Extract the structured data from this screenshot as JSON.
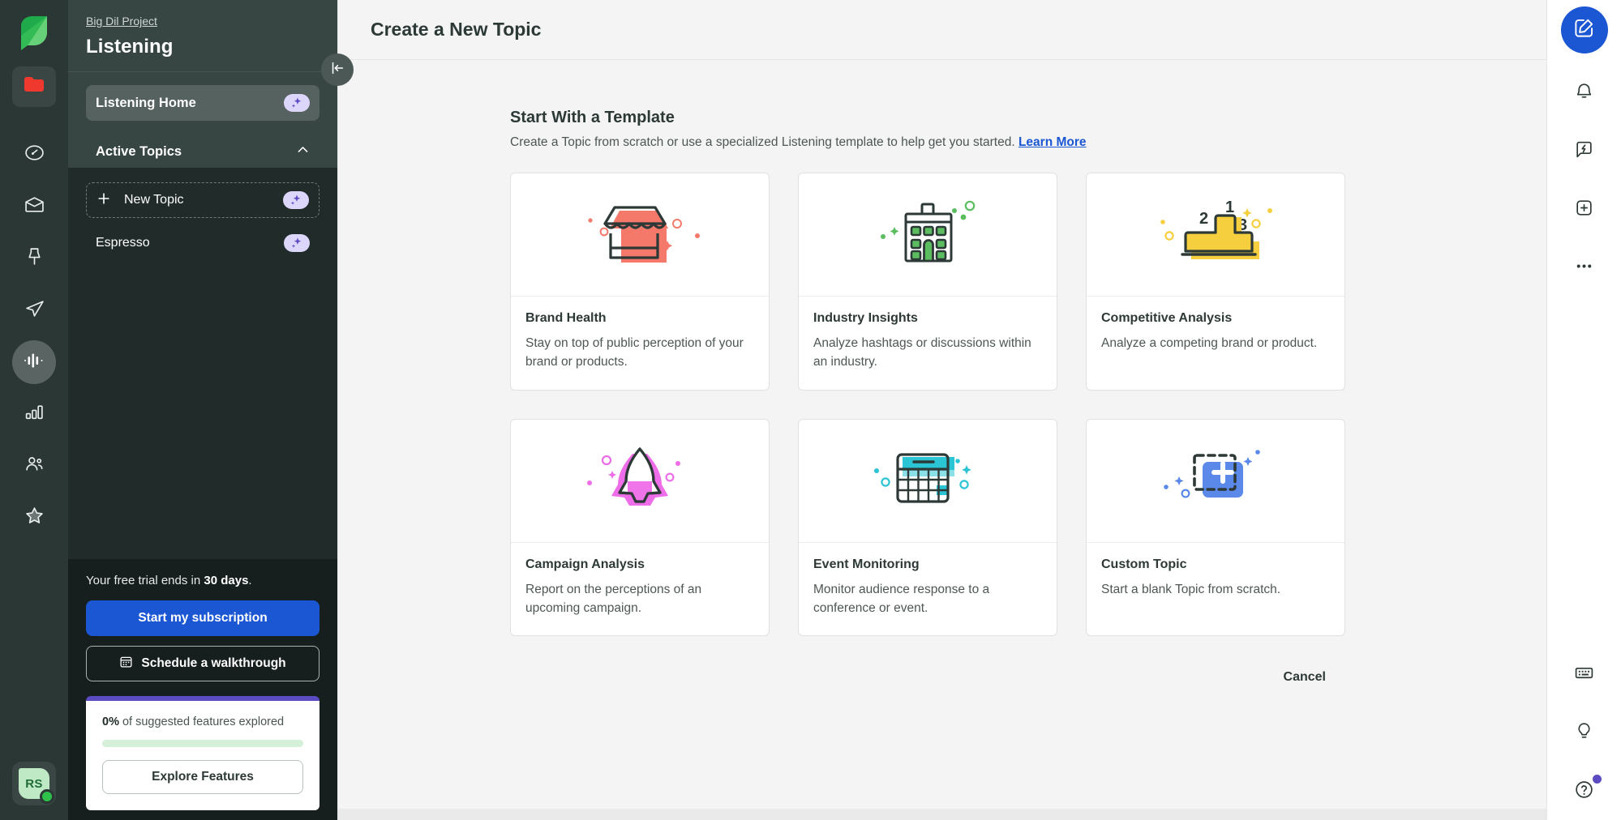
{
  "left_rail": {
    "logo": "sprout-leaf-logo",
    "items": [
      {
        "name": "folder",
        "icon": "folder-icon",
        "active": false
      },
      {
        "name": "dashboard",
        "icon": "speedometer-icon",
        "active": false
      },
      {
        "name": "inbox",
        "icon": "inbox-icon",
        "active": false
      },
      {
        "name": "publishing",
        "icon": "pin-icon",
        "active": false
      },
      {
        "name": "send",
        "icon": "paper-plane-icon",
        "active": false
      },
      {
        "name": "listening",
        "icon": "listening-waveform-icon",
        "active": true
      },
      {
        "name": "reports",
        "icon": "bar-chart-icon",
        "active": false
      },
      {
        "name": "employee-advocacy",
        "icon": "people-icon",
        "active": false
      },
      {
        "name": "reviews",
        "icon": "star-icon",
        "active": false
      }
    ],
    "avatar": {
      "initials": "RS",
      "status": "online",
      "status_color": "#2ec04a",
      "bg_color": "#bfe8c4"
    }
  },
  "sidebar": {
    "project_link": "Big Dil Project",
    "title": "Listening",
    "home_label": "Listening Home",
    "home_badge": "ai-sparkle-icon",
    "section_label": "Active Topics",
    "section_chevron": "chevron-up-icon",
    "new_topic_label": "New Topic",
    "new_topic_badge": "ai-sparkle-icon",
    "topics": [
      {
        "label": "Espresso",
        "badge": "ai-sparkle-icon"
      }
    ],
    "trial_prefix": "Your free trial ends in ",
    "trial_days": "30 days",
    "trial_suffix": ".",
    "subscribe_label": "Start my subscription",
    "walkthrough_label": "Schedule a walkthrough",
    "walkthrough_icon": "calendar-icon",
    "explore": {
      "percent": "0%",
      "percent_suffix": " of suggested features explored",
      "progress_value": 0,
      "button_label": "Explore Features",
      "accent_color": "#5b4cc4",
      "track_color": "#d5f0d8"
    },
    "collapse_icon": "collapse-left-icon"
  },
  "main": {
    "title": "Create a New Topic",
    "section_title": "Start With a Template",
    "section_subtitle": "Create a Topic from scratch or use a specialized Listening template to help get you started.",
    "learn_more": "Learn More",
    "cancel_label": "Cancel",
    "templates": [
      {
        "title": "Brand Health",
        "desc": "Stay on top of public perception of your brand or products.",
        "icon": "storefront-icon",
        "color": "#f4796b"
      },
      {
        "title": "Industry Insights",
        "desc": "Analyze hashtags or discussions within an industry.",
        "icon": "office-building-icon",
        "color": "#5bbd5f"
      },
      {
        "title": "Competitive Analysis",
        "desc": "Analyze a competing brand or product.",
        "icon": "podium-icon",
        "color": "#f6cf3f"
      },
      {
        "title": "Campaign Analysis",
        "desc": "Report on the perceptions of an upcoming campaign.",
        "icon": "rocket-icon",
        "color": "#ee6de8"
      },
      {
        "title": "Event Monitoring",
        "desc": "Monitor audience response to a conference or event.",
        "icon": "calendar-grid-icon",
        "color": "#2bc4d4"
      },
      {
        "title": "Custom Topic",
        "desc": "Start a blank Topic from scratch.",
        "icon": "dashed-plus-icon",
        "color": "#5a89ea"
      }
    ]
  },
  "right_rail": {
    "compose_icon": "compose-pencil-icon",
    "items": [
      {
        "name": "notifications",
        "icon": "bell-icon"
      },
      {
        "name": "feedback",
        "icon": "chat-bolt-icon"
      },
      {
        "name": "add",
        "icon": "add-square-icon"
      },
      {
        "name": "more",
        "icon": "ellipsis-icon"
      }
    ],
    "bottom_items": [
      {
        "name": "shortcuts",
        "icon": "keyboard-icon",
        "dot": false
      },
      {
        "name": "ideas",
        "icon": "lightbulb-icon",
        "dot": false
      },
      {
        "name": "help",
        "icon": "question-circle-icon",
        "dot": true
      }
    ],
    "dot_color": "#5b4cc4"
  }
}
